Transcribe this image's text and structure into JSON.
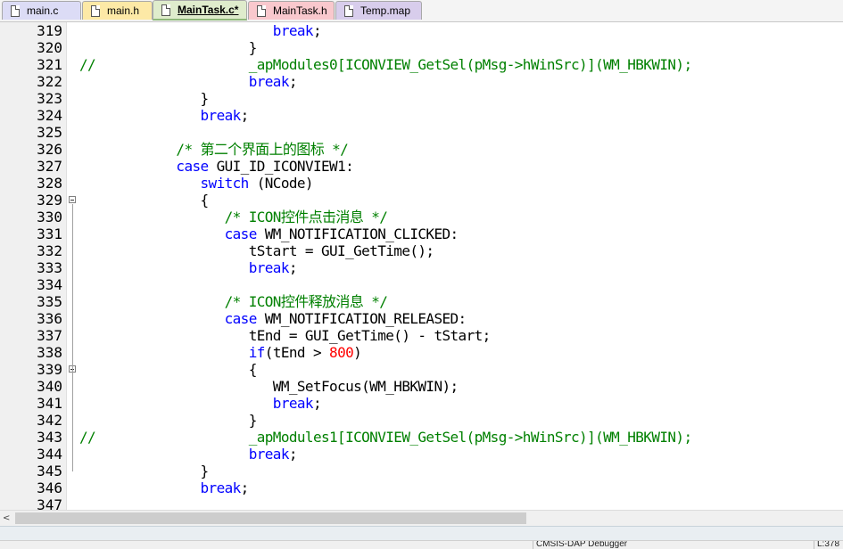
{
  "tabs": [
    {
      "label": "main.c",
      "color": "#dcdcf6",
      "active": false
    },
    {
      "label": "main.h",
      "color": "#fde9a6",
      "active": false
    },
    {
      "label": "MainTask.c*",
      "color": "#dfeccc",
      "active": true
    },
    {
      "label": "MainTask.h",
      "color": "#f9c8cd",
      "active": false
    },
    {
      "label": "Temp.map",
      "color": "#d8cdec",
      "active": false
    }
  ],
  "lines": [
    {
      "n": "319",
      "tokens": [
        {
          "t": "                        "
        },
        {
          "t": "break",
          "c": "kw"
        },
        {
          "t": ";"
        }
      ]
    },
    {
      "n": "320",
      "tokens": [
        {
          "t": "                     }"
        }
      ]
    },
    {
      "n": "321",
      "tokens": [
        {
          "t": "//                   _apModules0[ICONVIEW_GetSel(pMsg->hWinSrc)](WM_HBKWIN);",
          "c": "cm"
        }
      ]
    },
    {
      "n": "322",
      "tokens": [
        {
          "t": "                     "
        },
        {
          "t": "break",
          "c": "kw"
        },
        {
          "t": ";"
        }
      ]
    },
    {
      "n": "323",
      "tokens": [
        {
          "t": "               }"
        }
      ]
    },
    {
      "n": "324",
      "tokens": [
        {
          "t": "               "
        },
        {
          "t": "break",
          "c": "kw"
        },
        {
          "t": ";"
        }
      ]
    },
    {
      "n": "325",
      "tokens": [
        {
          "t": ""
        }
      ]
    },
    {
      "n": "326",
      "tokens": [
        {
          "t": "            "
        },
        {
          "t": "/* 第二个界面上的图标 */",
          "c": "cm"
        }
      ]
    },
    {
      "n": "327",
      "tokens": [
        {
          "t": "            "
        },
        {
          "t": "case",
          "c": "kw"
        },
        {
          "t": " GUI_ID_ICONVIEW1:"
        }
      ]
    },
    {
      "n": "328",
      "tokens": [
        {
          "t": "               "
        },
        {
          "t": "switch",
          "c": "kw"
        },
        {
          "t": " (NCode)"
        }
      ]
    },
    {
      "n": "329",
      "fold": true,
      "tokens": [
        {
          "t": "               {"
        }
      ]
    },
    {
      "n": "330",
      "tokens": [
        {
          "t": "                  "
        },
        {
          "t": "/* ICON控件点击消息 */",
          "c": "cm"
        }
      ]
    },
    {
      "n": "331",
      "tokens": [
        {
          "t": "                  "
        },
        {
          "t": "case",
          "c": "kw"
        },
        {
          "t": " WM_NOTIFICATION_CLICKED:"
        }
      ]
    },
    {
      "n": "332",
      "tokens": [
        {
          "t": "                     tStart = GUI_GetTime();"
        }
      ]
    },
    {
      "n": "333",
      "tokens": [
        {
          "t": "                     "
        },
        {
          "t": "break",
          "c": "kw"
        },
        {
          "t": ";"
        }
      ]
    },
    {
      "n": "334",
      "tokens": [
        {
          "t": ""
        }
      ]
    },
    {
      "n": "335",
      "tokens": [
        {
          "t": "                  "
        },
        {
          "t": "/* ICON控件释放消息 */",
          "c": "cm"
        }
      ]
    },
    {
      "n": "336",
      "tokens": [
        {
          "t": "                  "
        },
        {
          "t": "case",
          "c": "kw"
        },
        {
          "t": " WM_NOTIFICATION_RELEASED:"
        }
      ]
    },
    {
      "n": "337",
      "tokens": [
        {
          "t": "                     tEnd = GUI_GetTime() - tStart;"
        }
      ]
    },
    {
      "n": "338",
      "tokens": [
        {
          "t": "                     "
        },
        {
          "t": "if",
          "c": "kw"
        },
        {
          "t": "(tEnd > "
        },
        {
          "t": "800",
          "c": "num"
        },
        {
          "t": ")"
        }
      ]
    },
    {
      "n": "339",
      "fold": true,
      "tokens": [
        {
          "t": "                     {"
        }
      ]
    },
    {
      "n": "340",
      "tokens": [
        {
          "t": "                        WM_SetFocus(WM_HBKWIN);"
        }
      ]
    },
    {
      "n": "341",
      "tokens": [
        {
          "t": "                        "
        },
        {
          "t": "break",
          "c": "kw"
        },
        {
          "t": ";"
        }
      ]
    },
    {
      "n": "342",
      "tokens": [
        {
          "t": "                     }"
        }
      ]
    },
    {
      "n": "343",
      "tokens": [
        {
          "t": "//                   _apModules1[ICONVIEW_GetSel(pMsg->hWinSrc)](WM_HBKWIN);",
          "c": "cm"
        }
      ]
    },
    {
      "n": "344",
      "tokens": [
        {
          "t": "                     "
        },
        {
          "t": "break",
          "c": "kw"
        },
        {
          "t": ";"
        }
      ]
    },
    {
      "n": "345",
      "tokens": [
        {
          "t": "               }"
        }
      ]
    },
    {
      "n": "346",
      "tokens": [
        {
          "t": "               "
        },
        {
          "t": "break",
          "c": "kw"
        },
        {
          "t": ";"
        }
      ]
    },
    {
      "n": "347",
      "tokens": [
        {
          "t": ""
        }
      ]
    }
  ],
  "scrollbar": {
    "left_arrow": "<"
  },
  "status": {
    "encoding_text": "CMSIS-DAP Debugger",
    "position_text": "L:378"
  }
}
